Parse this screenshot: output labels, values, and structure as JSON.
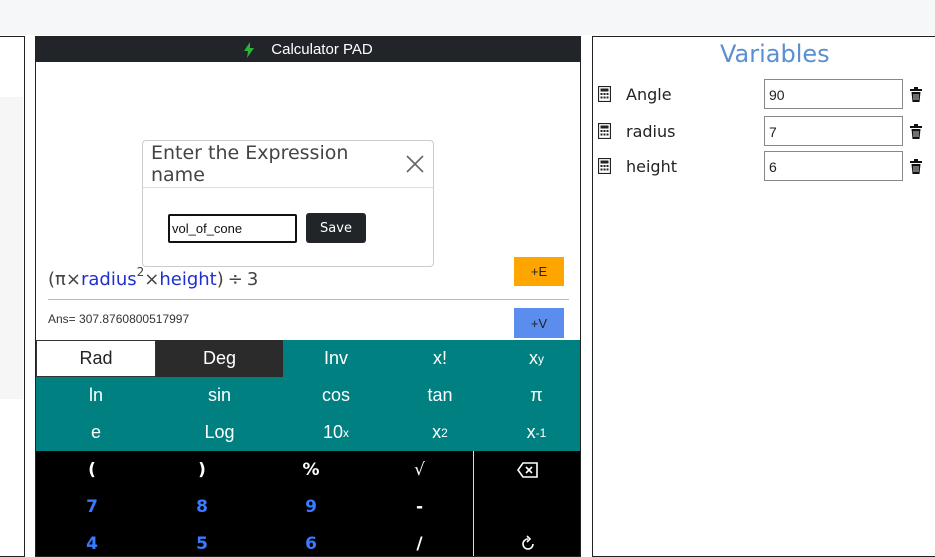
{
  "app": {
    "title": "Calculator PAD"
  },
  "calculator": {
    "expression": {
      "open": "(",
      "pi": "π",
      "times": "×",
      "var1": "radius",
      "sup1": "2",
      "var2": "height",
      "close": ")",
      "div": "÷",
      "num": "3"
    },
    "add_expression_label": "+E",
    "answer": "Ans= 307.8760800517997",
    "add_variable_label": "+V",
    "sci_rows": [
      [
        "Rad",
        "Deg",
        "Inv",
        "x!",
        "x^y"
      ],
      [
        "ln",
        "sin",
        "cos",
        "tan",
        "π"
      ],
      [
        "e",
        "Log",
        "10^x",
        "x^2",
        "x^-1"
      ]
    ],
    "keypad_rows": [
      [
        "(",
        ")",
        "%",
        "√",
        "backspace"
      ],
      [
        "7",
        "8",
        "9",
        "-",
        ""
      ],
      [
        "4",
        "5",
        "6",
        "/",
        "reset"
      ]
    ]
  },
  "modal": {
    "title": "Enter the Expression name",
    "input_value": "vol_of_cone",
    "save_label": "Save"
  },
  "variables": {
    "title": "Variables",
    "items": [
      {
        "name": "Angle",
        "value": "90"
      },
      {
        "name": "radius",
        "value": "7"
      },
      {
        "name": "height",
        "value": "6"
      }
    ]
  },
  "colors": {
    "header": "#212529",
    "sci_bg": "#008080",
    "add_expr": "#ffa500",
    "add_var": "#5b8def",
    "var_title": "#5b8fd0",
    "var_link": "#1f2fd0"
  }
}
